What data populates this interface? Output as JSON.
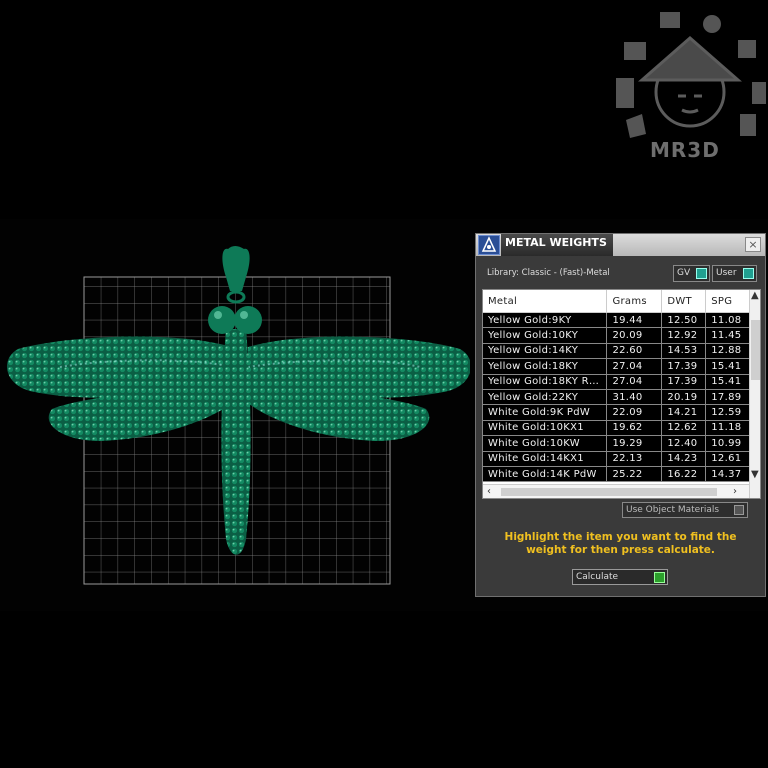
{
  "watermark": {
    "brand": "MR3D"
  },
  "panel": {
    "title": "METAL WEIGHTS",
    "close_glyph": "×",
    "library_label": "Library: Classic - (Fast)-Metal",
    "toggle_gv": "GV",
    "toggle_user": "User",
    "columns": [
      "Metal",
      "Grams",
      "DWT",
      "SPG"
    ],
    "rows": [
      [
        "Yellow Gold:9KY",
        "19.44",
        "12.50",
        "11.08"
      ],
      [
        "Yellow Gold:10KY",
        "20.09",
        "12.92",
        "11.45"
      ],
      [
        "Yellow Gold:14KY",
        "22.60",
        "14.53",
        "12.88"
      ],
      [
        "Yellow Gold:18KY",
        "27.04",
        "17.39",
        "15.41"
      ],
      [
        "Yellow Gold:18KY R…",
        "27.04",
        "17.39",
        "15.41"
      ],
      [
        "Yellow Gold:22KY",
        "31.40",
        "20.19",
        "17.89"
      ],
      [
        "White Gold:9K PdW",
        "22.09",
        "14.21",
        "12.59"
      ],
      [
        "White Gold:10KX1",
        "19.62",
        "12.62",
        "11.18"
      ],
      [
        "White Gold:10KW",
        "19.29",
        "12.40",
        "10.99"
      ],
      [
        "White Gold:14KX1",
        "22.13",
        "14.23",
        "12.61"
      ],
      [
        "White Gold:14K PdW",
        "25.22",
        "16.22",
        "14.37"
      ]
    ],
    "use_object_materials": "Use Object Materials",
    "instruction": "Highlight the item you want to find the weight for then press calculate.",
    "calculate_label": "Calculate"
  },
  "colors": {
    "model_green": "#0f7a5a",
    "instruction_text": "#f0c020",
    "accent": "#20a090"
  },
  "icons": [
    "metal-weights-icon",
    "close-icon",
    "mr3d-logo-icon"
  ]
}
